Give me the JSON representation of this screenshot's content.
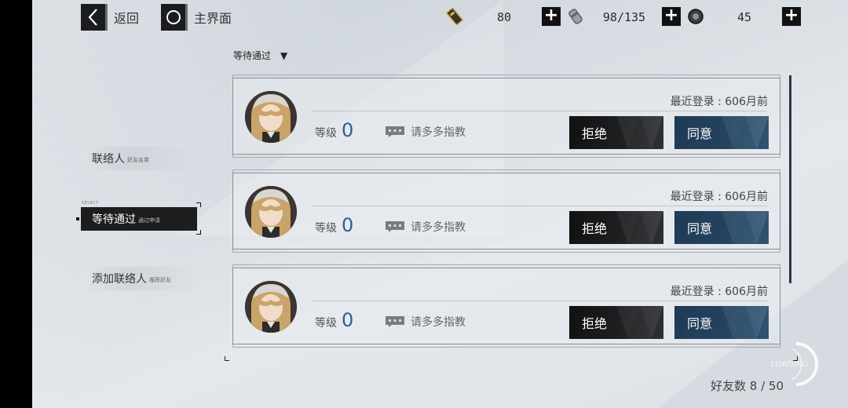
{
  "topbar": {
    "back_label": "返回",
    "home_label": "主界面",
    "resources": [
      {
        "icon": "ticket-icon",
        "value": "80"
      },
      {
        "icon": "ration-icon",
        "value": "98/135"
      },
      {
        "icon": "parts-icon",
        "value": "45"
      }
    ]
  },
  "filter": {
    "label": "等待通过"
  },
  "nav": {
    "select_tag": "SELECT",
    "items": [
      {
        "label": "联络人",
        "sub": "好友名单"
      },
      {
        "label": "等待通过",
        "sub": "通过申请"
      },
      {
        "label": "添加联络人",
        "sub": "推荐好友"
      }
    ]
  },
  "requests": [
    {
      "last_login": "最近登录 : 606月前",
      "level_label": "等级",
      "level": "0",
      "message": "请多多指教",
      "reject": "拒绝",
      "accept": "同意"
    },
    {
      "last_login": "最近登录 : 606月前",
      "level_label": "等级",
      "level": "0",
      "message": "请多多指教",
      "reject": "拒绝",
      "accept": "同意"
    },
    {
      "last_login": "最近登录 : 606月前",
      "level_label": "等级",
      "level": "0",
      "message": "请多多指教",
      "reject": "拒绝",
      "accept": "同意"
    }
  ],
  "footer": {
    "friend_count": "好友数  8 / 50",
    "loading": "LOADING"
  },
  "colors": {
    "accent_blue": "#24435f",
    "level_blue": "#2a5f97",
    "dark_button": "#1a1b1d"
  }
}
